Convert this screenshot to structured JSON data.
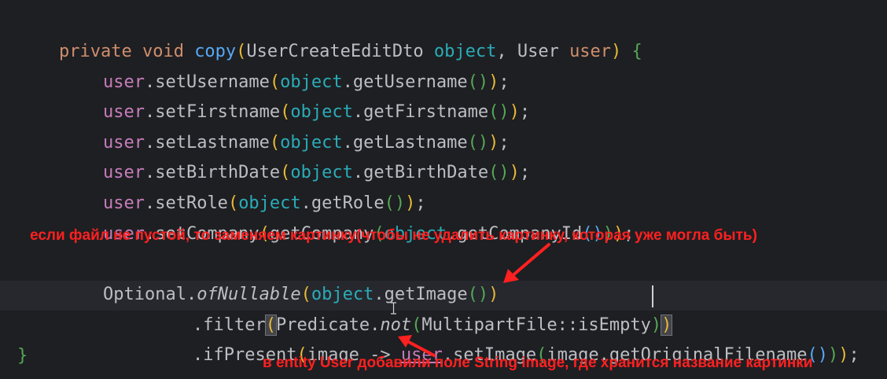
{
  "code": {
    "line1": {
      "private": "private",
      "void": "void",
      "method": "copy",
      "open": "(",
      "type1": "UserCreateEditDto",
      "param1": "object",
      "comma": ",",
      "type2": "User",
      "param2": "user",
      "close": ")",
      "brace": "{"
    },
    "setters": [
      {
        "target": "user",
        "call": ".setUsername",
        "arg_obj": "object",
        "arg_call": ".getUsername",
        "end": ";"
      },
      {
        "target": "user",
        "call": ".setFirstname",
        "arg_obj": "object",
        "arg_call": ".getFirstname",
        "end": ";"
      },
      {
        "target": "user",
        "call": ".setLastname",
        "arg_obj": "object",
        "arg_call": ".getLastname",
        "end": ";"
      },
      {
        "target": "user",
        "call": ".setBirthDate",
        "arg_obj": "object",
        "arg_call": ".getBirthDate",
        "end": ";"
      },
      {
        "target": "user",
        "call": ".setRole",
        "arg_obj": "object",
        "arg_call": ".getRole",
        "end": ";"
      }
    ],
    "company_line": {
      "target": "user",
      "call": ".setCompany",
      "inner_call": "getCompany",
      "arg_obj": "object",
      "arg_call": ".getCompanyId",
      "end": ";"
    },
    "optional_line": {
      "cls": "Optional",
      "dot": ".",
      "static_call": "ofNullable",
      "arg_obj": "object",
      "arg_call": ".getImage"
    },
    "filter_line": {
      "call": ".filter",
      "cls": "Predicate",
      "dot": ".",
      "static_call": "not",
      "ref": "MultipartFile::isEmpty"
    },
    "ifpresent_line": {
      "call": ".ifPresent",
      "lambda_param": "image",
      "arrow": "->",
      "target": "user",
      "set_call": ".setImage",
      "arg_obj": "image",
      "arg_call": ".getOriginalFilename",
      "end": ";"
    },
    "closing_brace": "}"
  },
  "annotations": {
    "top_note": "если файл не пустой, то заменяем картинку(чтобы не удалить картинку, которая уже могла быть)",
    "bottom_note": "в entity User добавили поле String image, где хранится название картинки",
    "color": "#ff2020"
  },
  "theme": {
    "background": "#1e1f22",
    "keyword": "#cf8e6d",
    "method": "#56a8f5",
    "field": "#c77dbb",
    "parameter": "#2aacb8"
  }
}
